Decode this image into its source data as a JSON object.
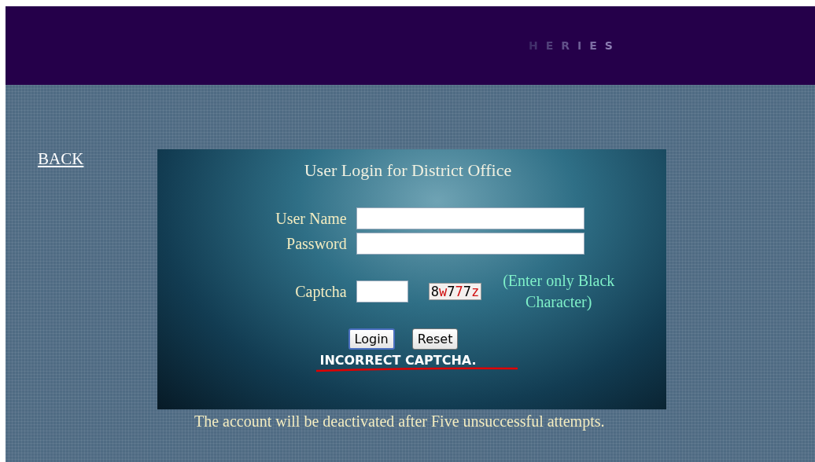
{
  "header": {
    "brand": "HERIES"
  },
  "back_link": "BACK",
  "login": {
    "title": "User Login for District Office",
    "fields": [
      {
        "label": "User Name",
        "kind": "wide"
      },
      {
        "label": "Password",
        "kind": "wide"
      },
      {
        "label": "Captcha",
        "kind": "short"
      }
    ],
    "captcha": [
      {
        "char": "8",
        "color": "#000000"
      },
      {
        "char": "w",
        "color": "#d01010"
      },
      {
        "char": "7",
        "color": "#000000"
      },
      {
        "char": "7",
        "color": "#d01010"
      },
      {
        "char": "7",
        "color": "#000000"
      },
      {
        "char": "z",
        "color": "#d01010"
      }
    ],
    "captcha_hint": "(Enter only Black Character)",
    "buttons": [
      {
        "label": "Login",
        "focused": true
      },
      {
        "label": "Reset",
        "focused": false
      }
    ],
    "error": "INCORRECT CAPTCHA."
  },
  "footer_note": "The account will be deactivated after Five unsuccessful attempts."
}
